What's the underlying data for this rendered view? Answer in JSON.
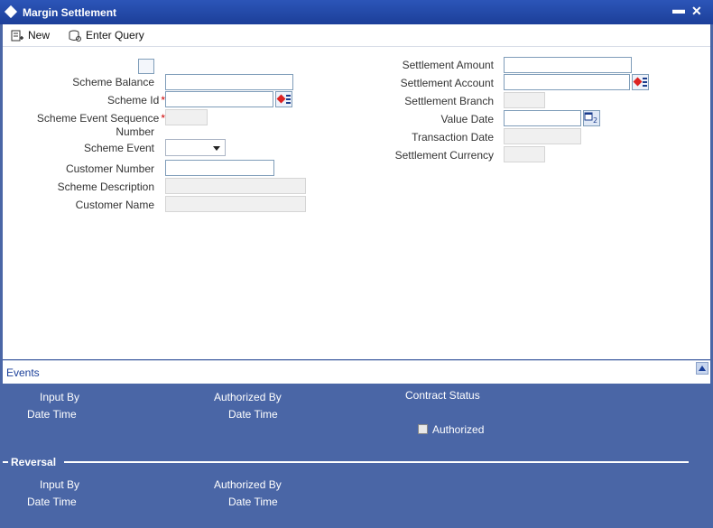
{
  "window": {
    "title": "Margin Settlement",
    "minimize": "▬",
    "close": "✕"
  },
  "toolbar": {
    "new_label": "New",
    "enter_query_label": "Enter Query"
  },
  "form_left": {
    "scheme_balance": "Scheme Balance",
    "scheme_id": "Scheme Id",
    "scheme_event_seq_1": "Scheme Event Sequence",
    "scheme_event_seq_2": "Number",
    "scheme_event": "Scheme Event",
    "customer_number": "Customer Number",
    "scheme_description": "Scheme Description",
    "customer_name": "Customer Name",
    "required_mark": "*"
  },
  "form_right": {
    "settlement_amount": "Settlement Amount",
    "settlement_account": "Settlement Account",
    "settlement_branch": "Settlement Branch",
    "value_date": "Value Date",
    "transaction_date": "Transaction Date",
    "settlement_currency": "Settlement Currency"
  },
  "events": {
    "label": "Events"
  },
  "footer": {
    "input_by": "Input By",
    "date_time": "Date Time",
    "authorized_by": "Authorized By",
    "contract_status": "Contract Status",
    "authorized": "Authorized",
    "reversal": "Reversal"
  },
  "colors": {
    "title_bar": "#1c3f99",
    "footer_bg": "#4a66a6",
    "required": "#cc0000",
    "link": "#1a3f99"
  },
  "icons": [
    "new-icon",
    "enter-query-icon",
    "lov-icon",
    "calendar-icon",
    "dropdown-caret-icon",
    "collapse-up-icon"
  ]
}
